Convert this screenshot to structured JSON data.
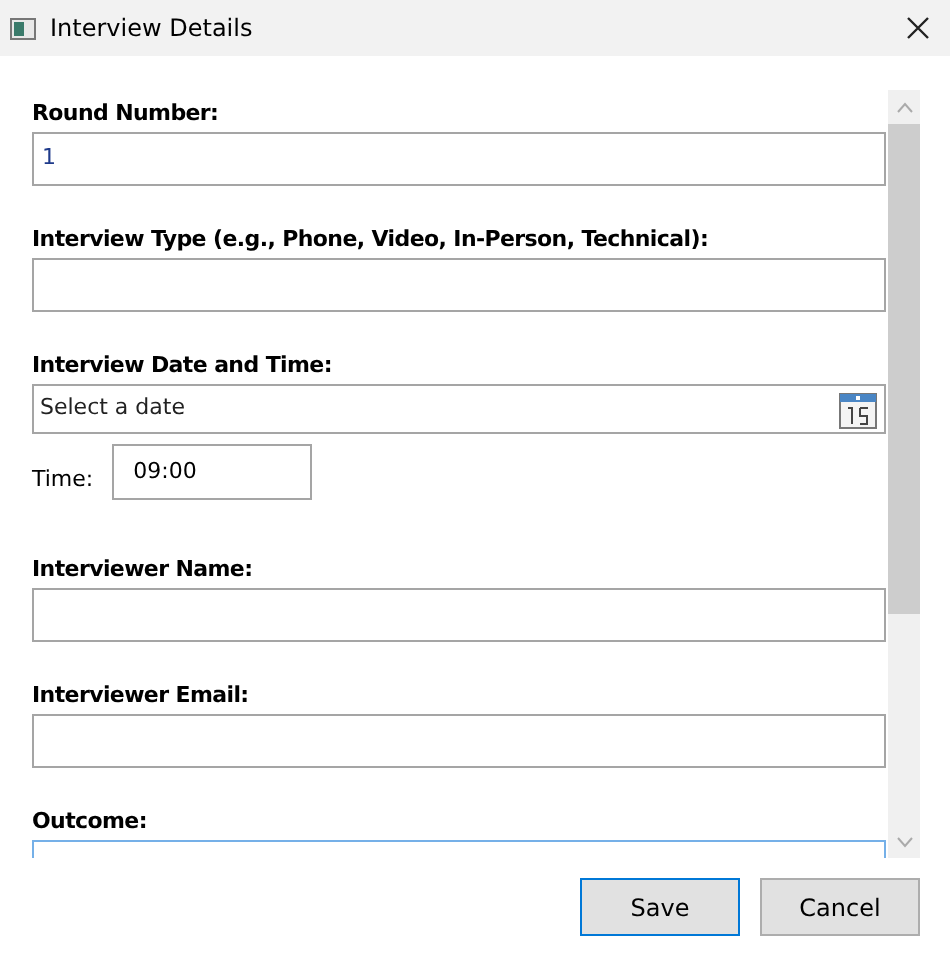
{
  "window": {
    "title": "Interview Details"
  },
  "fields": [
    {
      "kind": "text",
      "label": "Round Number:",
      "value": "1",
      "focused": false
    },
    {
      "kind": "text",
      "label": "Interview Type (e.g., Phone, Video, In-Person, Technical):",
      "focused": false
    },
    {
      "kind": "date",
      "label": "Interview Date and Time:",
      "placeholder": "Select a date",
      "time_label": "Time:",
      "time_value": "09:00",
      "focused": false
    },
    {
      "kind": "text",
      "label": "Interviewer Name:",
      "focused": false
    },
    {
      "kind": "text",
      "label": "Interviewer Email:",
      "focused": false
    },
    {
      "kind": "text",
      "label": "Outcome:",
      "focused": true
    }
  ],
  "buttons": [
    {
      "label": "Save",
      "default": true
    },
    {
      "label": "Cancel",
      "default": false
    }
  ]
}
